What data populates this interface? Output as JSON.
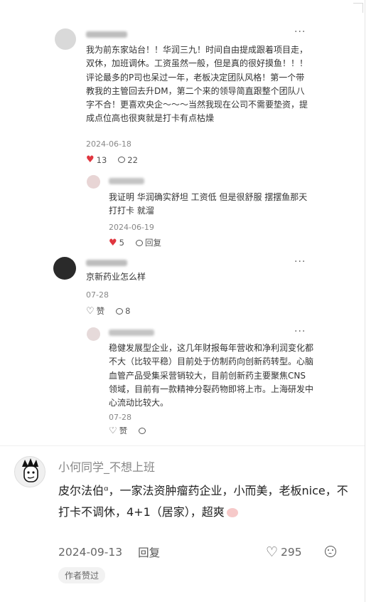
{
  "comments": [
    {
      "text": "我为前东家站台！！华润三九！时间自由提成跟着项目走，双休，加班调休。工资虽然一般，但是真的很好摸鱼！！！评论最多的P司也呆过一年，老板决定团队风格！第一个带教我的主管回去升DM，第二个来的领导简直跟整个团队八字不合！更喜欢央企～～～当然我现在公司不需要垫资，提成点位高也很爽就是打卡有点枯燥",
      "date": "2024-06-18",
      "likes": "13",
      "reply_count": "22",
      "replies": [
        {
          "text": "我证明 华润确实舒坦 工资低 但是很舒服 摆摆鱼那天打打卡 就溜",
          "date": "2024-06-19",
          "likes": "5",
          "reply_label": "回复"
        }
      ]
    },
    {
      "text": "京新药业怎么样",
      "date": "07-28",
      "like_label": "赞",
      "reply_count": "8",
      "replies": [
        {
          "text": "稳健发展型企业，这几年财报每年营收和净利润变化都不大（比较平稳）目前处于仿制药向创新药转型。心脑血管产品受集采营销较大，目前创新药主要聚焦CNS领域，目前有一款精神分裂药物即将上市。上海研发中心流动比较大。",
          "date": "07-28",
          "like_label": "赞"
        }
      ]
    }
  ],
  "featured": {
    "username": "小何同学_不想上班",
    "text": "皮尔法伯ᵅ，一家法资肿瘤药企业，小而美，老板nice，不打卡不调休，4+1（居家），超爽",
    "date": "2024-09-13",
    "reply_label": "回复",
    "likes": "295",
    "badge": "作者赞过"
  },
  "icons": {
    "more": "more-dots-icon",
    "like": "heart-icon",
    "reply": "comment-bubble-icon",
    "dislike": "dislike-face-icon"
  },
  "colors": {
    "like_active": "#e0363f",
    "meta": "#888888"
  }
}
